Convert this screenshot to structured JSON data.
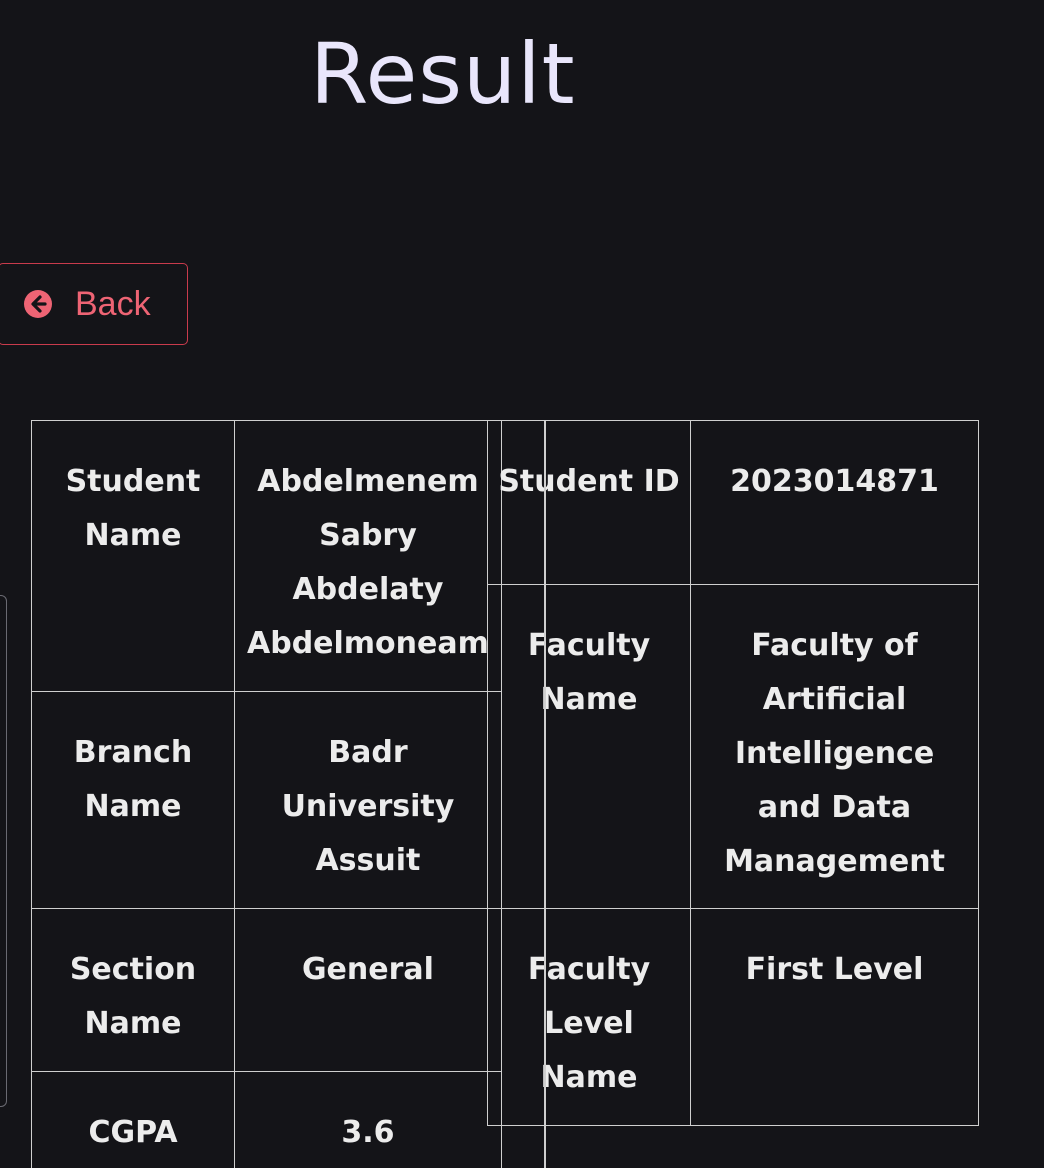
{
  "page": {
    "title": "Result"
  },
  "back_button": {
    "label": "Back",
    "icon": "arrow-circle-left-icon",
    "color": "#ee6474",
    "border_color": "#c93b4c"
  },
  "student_table": {
    "rows": [
      {
        "label": "Student Name",
        "value": "Abdelmenem Sabry Abdelaty Abdelmoneam"
      },
      {
        "label": "Branch Name",
        "value": "Badr University Assuit"
      },
      {
        "label": "Section Name",
        "value": "General"
      },
      {
        "label": "CGPA",
        "value": "3.6"
      }
    ]
  },
  "faculty_table": {
    "rows": [
      {
        "label": "Student ID",
        "value": "2023014871"
      },
      {
        "label": "Faculty Name",
        "value": "Faculty of Artificial Intelligence and Data Management"
      },
      {
        "label": "Faculty Level Name",
        "value": "First Level"
      }
    ]
  },
  "colors": {
    "background": "#141418",
    "border": "#cfcfcf",
    "title": "#e9e6fb",
    "text": "#ececec"
  }
}
